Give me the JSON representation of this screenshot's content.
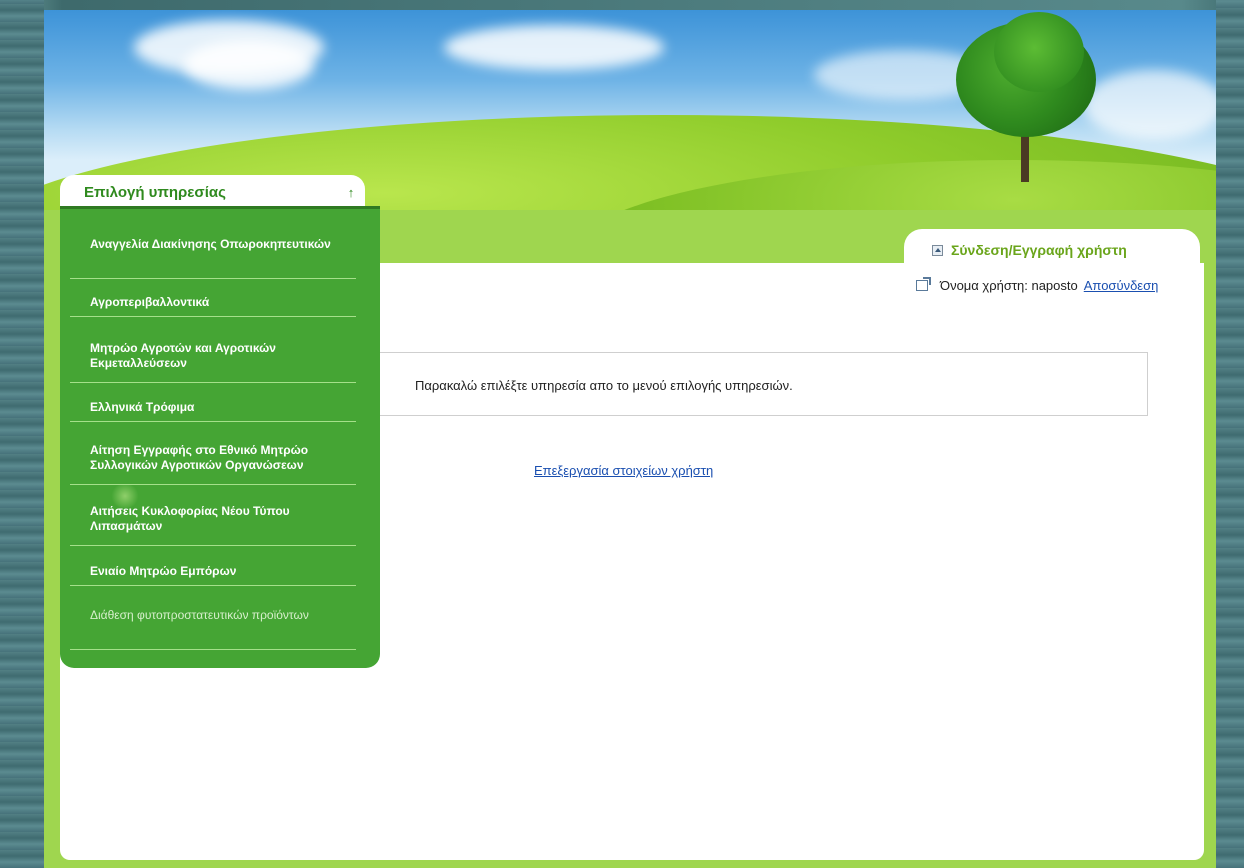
{
  "service_selector": {
    "title": "Επιλογή υπηρεσίας",
    "toggle_icon": "collapse-toggle-icon",
    "items": [
      {
        "label": "Αναγγελία Διακίνησης Οπωροκηπευτικών"
      },
      {
        "label": "Αγροπεριβαλλοντικά"
      },
      {
        "label": "Μητρώο Αγροτών και Αγροτικών Εκμεταλλεύσεων"
      },
      {
        "label": "Ελληνικά Τρόφιμα"
      },
      {
        "label": "Αίτηση Εγγραφής στο Εθνικό Μητρώο Συλλογικών Αγροτικών Οργανώσεων"
      },
      {
        "label": "Αιτήσεις Κυκλοφορίας Νέου Τύπου Λιπασμάτων"
      },
      {
        "label": "Ενιαίο Μητρώο Εμπόρων"
      },
      {
        "label": "Διάθεση φυτοπροστατευτικών προϊόντων"
      }
    ]
  },
  "login": {
    "title": "Σύνδεση/Εγγραφή χρήστη",
    "username_label": "Όνομα χρήστη: naposto",
    "logout_link": "Αποσύνδεση"
  },
  "main": {
    "message": "Παρακαλώ επιλέξτε υπηρεσία απο το μενού επιλογής υπηρεσιών.",
    "edit_user_link": "Επεξεργασία στοιχείων χρήστη"
  },
  "colors": {
    "accent_green": "#45a534",
    "light_green": "#9fd64f",
    "link_blue": "#1a4fb0"
  }
}
